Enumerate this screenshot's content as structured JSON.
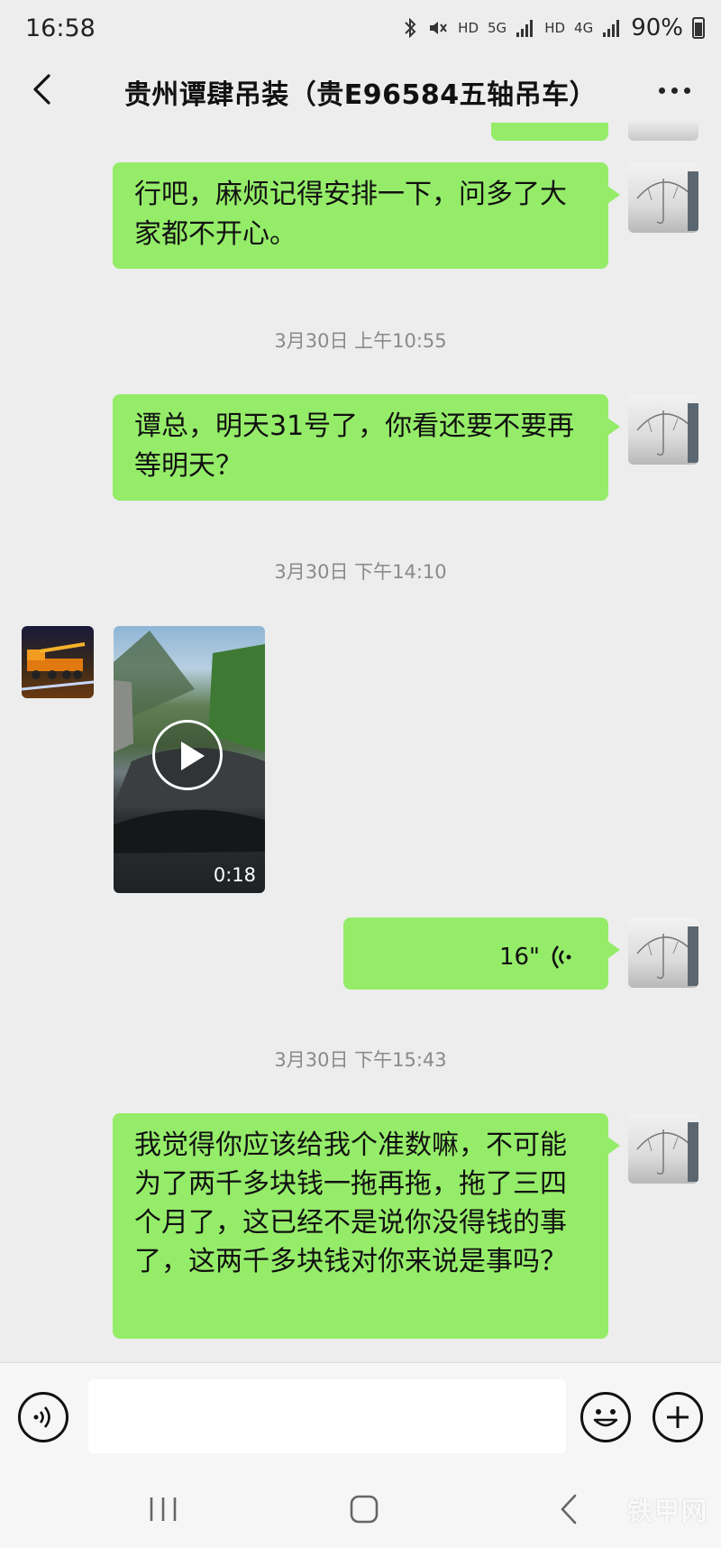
{
  "status_bar": {
    "time": "16:58",
    "hd1": "HD",
    "net": "5G",
    "hd2": "HD",
    "net2": "4G",
    "battery": "90%"
  },
  "header": {
    "title": "贵州谭肆吊装（贵E96584五轴吊车）"
  },
  "messages": {
    "m1": {
      "text": "行吧，麻烦记得安排一下，问多了大家都不开心。"
    },
    "ts1": "3月30日 上午10:55",
    "m2": {
      "text": "谭总，明天31号了，你看还要不要再等明天？"
    },
    "ts2": "3月30日 下午14:10",
    "video": {
      "duration": "0:18"
    },
    "voice": {
      "duration": "16\""
    },
    "ts3": "3月30日 下午15:43",
    "m3": {
      "text": "我觉得你应该给我个准数嘛，不可能为了两千多块钱一拖再拖，拖了三四个月了，这已经不是说你没得钱的事了，这两千多块钱对你来说是事吗？"
    }
  },
  "colors": {
    "bubble_self": "#95ec69",
    "background": "#ededed"
  },
  "icons": {
    "back": "chevron-left-icon",
    "more": "more-dots-icon",
    "voice_input": "voice-icon",
    "emoji": "emoji-icon",
    "plus": "plus-icon",
    "play": "play-icon"
  },
  "watermark": "铁甲网"
}
